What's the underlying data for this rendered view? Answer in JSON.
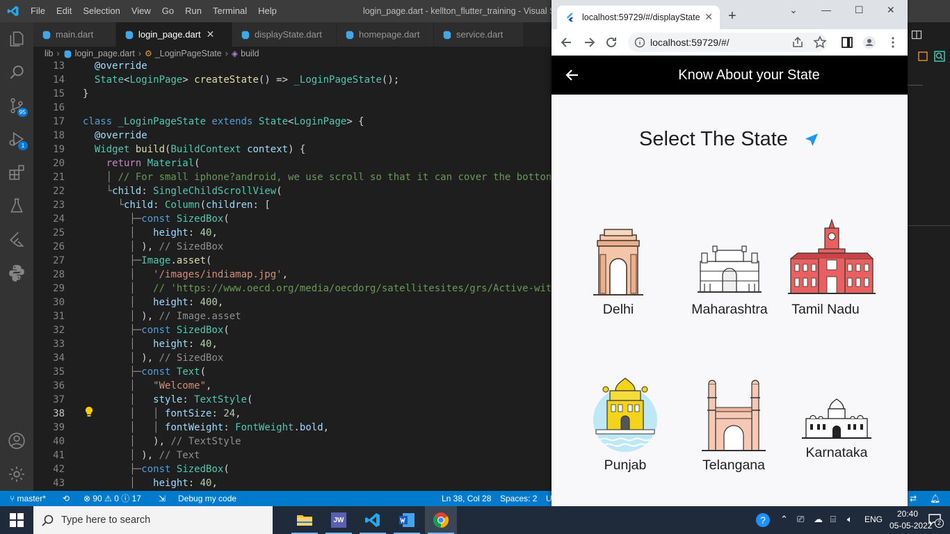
{
  "vscode": {
    "menu": [
      "File",
      "Edit",
      "Selection",
      "View",
      "Go",
      "Run",
      "Terminal",
      "Help"
    ],
    "window_title": "login_page.dart - kellton_flutter_training - Visual Stu",
    "activity": {
      "source_control_badge": "95",
      "debug_badge": "1"
    },
    "tabs": [
      {
        "label": "main.dart"
      },
      {
        "label": "login_page.dart",
        "active": true
      },
      {
        "label": "displayState.dart"
      },
      {
        "label": "homepage.dart"
      },
      {
        "label": "service.dart"
      }
    ],
    "breadcrumb": [
      "lib",
      "login_page.dart",
      "_LoginPageState",
      "build"
    ],
    "line_numbers": [
      "13",
      "14",
      "15",
      "16",
      "17",
      "18",
      "19",
      "20",
      "21",
      "22",
      "23",
      "24",
      "25",
      "26",
      "27",
      "28",
      "29",
      "30",
      "31",
      "32",
      "33",
      "34",
      "35",
      "36",
      "37",
      "38",
      "39",
      "40",
      "41",
      "42",
      "43"
    ],
    "current_line": "38",
    "code": {
      "l13": "@override",
      "l14a": "State",
      "l14b": "<",
      "l14c": "LoginPage",
      "l14d": "> ",
      "l14e": "createState",
      "l14f": "() => ",
      "l14g": "_LoginPageState",
      "l14h": "();",
      "l15": "}",
      "l17a": "class ",
      "l17b": "_LoginPageState",
      "l17c": " extends ",
      "l17d": "State",
      "l17e": "<",
      "l17f": "LoginPage",
      "l17g": "> {",
      "l18": "@override",
      "l19a": "Widget",
      "l19b": " ",
      "l19c": "build",
      "l19d": "(",
      "l19e": "BuildContext",
      "l19f": " ",
      "l19g": "context",
      "l19h": ") {",
      "l20a": "return",
      "l20b": " ",
      "l20c": "Material",
      "l20d": "(",
      "l21": "// For small iphone?android, we use scroll so that it can cover the botton",
      "l22a": "child",
      "l22b": ": ",
      "l22c": "SingleChildScrollView",
      "l22d": "(",
      "l23a": "child",
      "l23b": ": ",
      "l23c": "Column",
      "l23d": "(",
      "l23e": "children",
      "l23f": ": [",
      "l24a": "const",
      "l24b": " ",
      "l24c": "SizedBox",
      "l24d": "(",
      "l25a": "height",
      "l25b": ": ",
      "l25c": "40",
      "l25d": ",",
      "l26a": "), ",
      "l26b": "// SizedBox",
      "l27a": "Image",
      "l27b": ".",
      "l27c": "asset",
      "l27d": "(",
      "l28a": "'/images/indiamap.jpg'",
      "l28b": ",",
      "l29": "// 'https://www.oecd.org/media/oecdorg/satellitesites/grs/Active-wit",
      "l30a": "height",
      "l30b": ": ",
      "l30c": "400",
      "l30d": ",",
      "l31a": "), ",
      "l31b": "// Image.asset",
      "l32a": "const",
      "l32b": " ",
      "l32c": "SizedBox",
      "l32d": "(",
      "l33a": "height",
      "l33b": ": ",
      "l33c": "40",
      "l33d": ",",
      "l34a": "), ",
      "l34b": "// SizedBox",
      "l35a": "const",
      "l35b": " ",
      "l35c": "Text",
      "l35d": "(",
      "l36a": "\"Welcome\"",
      "l36b": ",",
      "l37a": "style",
      "l37b": ": ",
      "l37c": "TextStyle",
      "l37d": "(",
      "l38a": "fontSize",
      "l38b": ": ",
      "l38c": "24",
      "l38d": ",",
      "l39a": "fontWeight",
      "l39b": ": ",
      "l39c": "FontWeight",
      "l39d": ".",
      "l39e": "bold",
      "l39f": ",",
      "l40a": "), ",
      "l40b": "// TextStyle",
      "l41a": "), ",
      "l41b": "// Text",
      "l42a": "const",
      "l42b": " ",
      "l42c": "SizedBox",
      "l42d": "(",
      "l43a": "height",
      "l43b": ": ",
      "l43c": "40",
      "l43d": ","
    },
    "status": {
      "branch": "master*",
      "errors": "90",
      "warnings": "0",
      "infos": "17",
      "debug": "Debug my code",
      "position": "Ln 38, Col 28",
      "spaces": "Spaces: 2",
      "trunc": "U"
    }
  },
  "browser": {
    "tab_title": "localhost:59729/#/displayState",
    "url": "localhost:59729/#/"
  },
  "app": {
    "appbar_title": "Know About your State",
    "heading": "Select The State",
    "states": [
      {
        "name": "Delhi",
        "icon": "india-gate-icon"
      },
      {
        "name": "Maharashtra",
        "icon": "gateway-of-india-icon"
      },
      {
        "name": "Tamil Nadu",
        "icon": "chennai-central-icon"
      },
      {
        "name": "Punjab",
        "icon": "golden-temple-icon"
      },
      {
        "name": "Telangana",
        "icon": "charminar-icon"
      },
      {
        "name": "Karnataka",
        "icon": "mysore-palace-icon"
      }
    ]
  },
  "taskbar": {
    "search_placeholder": "Type here to search",
    "apps": [
      "File Explorer",
      "JW",
      "Visual Studio Code",
      "Word",
      "Chrome"
    ],
    "jw_label": "JW",
    "language": "ENG",
    "time": "20:40",
    "date": "05-05-2022",
    "notifications": "2"
  },
  "colors": {
    "vscode_blue": "#007acc",
    "appbar": "#000000",
    "accent": "#2196f3",
    "taskbar": "#1f2b3a"
  }
}
